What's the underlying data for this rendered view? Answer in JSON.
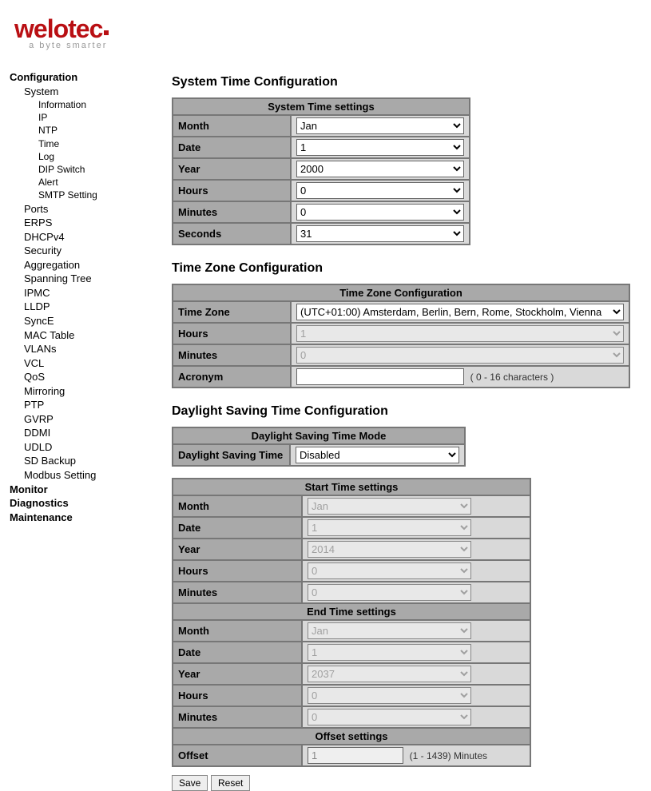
{
  "brand": {
    "name": "weloTec",
    "tagline": "a byte smarter"
  },
  "sidebar": {
    "top": [
      {
        "label": "Configuration",
        "bold": true
      },
      {
        "label": "System",
        "indent": 1
      },
      {
        "label": "Information",
        "indent": 2
      },
      {
        "label": "IP",
        "indent": 2
      },
      {
        "label": "NTP",
        "indent": 2
      },
      {
        "label": "Time",
        "indent": 2
      },
      {
        "label": "Log",
        "indent": 2
      },
      {
        "label": "DIP Switch",
        "indent": 2
      },
      {
        "label": "Alert",
        "indent": 2
      },
      {
        "label": "SMTP Setting",
        "indent": 2
      },
      {
        "label": "Ports",
        "indent": 1
      },
      {
        "label": "ERPS",
        "indent": 1
      },
      {
        "label": "DHCPv4",
        "indent": 1
      },
      {
        "label": "Security",
        "indent": 1
      },
      {
        "label": "Aggregation",
        "indent": 1
      },
      {
        "label": "Spanning Tree",
        "indent": 1
      },
      {
        "label": "IPMC",
        "indent": 1
      },
      {
        "label": "LLDP",
        "indent": 1
      },
      {
        "label": "SyncE",
        "indent": 1
      },
      {
        "label": "MAC Table",
        "indent": 1
      },
      {
        "label": "VLANs",
        "indent": 1
      },
      {
        "label": "VCL",
        "indent": 1
      },
      {
        "label": "QoS",
        "indent": 1
      },
      {
        "label": "Mirroring",
        "indent": 1
      },
      {
        "label": "PTP",
        "indent": 1
      },
      {
        "label": "GVRP",
        "indent": 1
      },
      {
        "label": "DDMI",
        "indent": 1
      },
      {
        "label": "UDLD",
        "indent": 1
      },
      {
        "label": "SD Backup",
        "indent": 1
      },
      {
        "label": "Modbus Setting",
        "indent": 1
      },
      {
        "label": "Monitor",
        "bold": true
      },
      {
        "label": "Diagnostics",
        "bold": true
      },
      {
        "label": "Maintenance",
        "bold": true
      }
    ]
  },
  "content": {
    "systime": {
      "heading": "System Time Configuration",
      "section": "System Time settings",
      "rows": [
        {
          "label": "Month",
          "value": "Jan"
        },
        {
          "label": "Date",
          "value": "1"
        },
        {
          "label": "Year",
          "value": "2000"
        },
        {
          "label": "Hours",
          "value": "0"
        },
        {
          "label": "Minutes",
          "value": "0"
        },
        {
          "label": "Seconds",
          "value": "31"
        }
      ]
    },
    "tz": {
      "heading": "Time Zone Configuration",
      "section": "Time Zone Configuration",
      "tz_label": "Time Zone",
      "tz_value": "(UTC+01:00) Amsterdam, Berlin, Bern, Rome, Stockholm, Vienna",
      "hours_label": "Hours",
      "hours_value": "1",
      "minutes_label": "Minutes",
      "minutes_value": "0",
      "acronym_label": "Acronym",
      "acronym_value": "",
      "acronym_hint": "( 0 - 16 characters )"
    },
    "dst": {
      "heading": "Daylight Saving Time Configuration",
      "mode_section": "Daylight Saving Time Mode",
      "mode_label": "Daylight Saving Time",
      "mode_value": "Disabled",
      "start_section": "Start Time settings",
      "start": [
        {
          "label": "Month",
          "value": "Jan"
        },
        {
          "label": "Date",
          "value": "1"
        },
        {
          "label": "Year",
          "value": "2014"
        },
        {
          "label": "Hours",
          "value": "0"
        },
        {
          "label": "Minutes",
          "value": "0"
        }
      ],
      "end_section": "End Time settings",
      "end": [
        {
          "label": "Month",
          "value": "Jan"
        },
        {
          "label": "Date",
          "value": "1"
        },
        {
          "label": "Year",
          "value": "2037"
        },
        {
          "label": "Hours",
          "value": "0"
        },
        {
          "label": "Minutes",
          "value": "0"
        }
      ],
      "offset_section": "Offset settings",
      "offset_label": "Offset",
      "offset_value": "1",
      "offset_hint": "(1 - 1439) Minutes"
    },
    "buttons": {
      "save": "Save",
      "reset": "Reset"
    }
  }
}
